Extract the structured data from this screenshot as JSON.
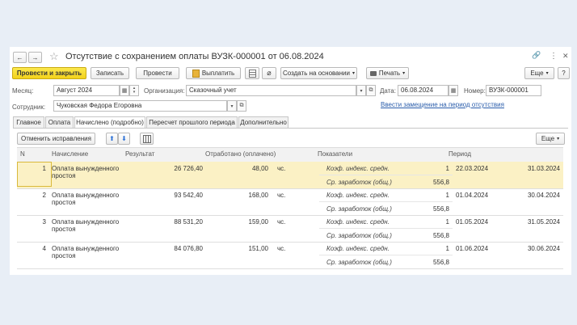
{
  "window": {
    "title": "Отсутствие с сохранением оплаты ВУЗК-000001 от 06.08.2024",
    "nav_back_icon": "←",
    "nav_forward_icon": "→",
    "star_icon": "☆",
    "link_icon": "🔗",
    "menu_icon": "⋮",
    "close_icon": "✕"
  },
  "toolbar": {
    "post_close": "Провести и закрыть",
    "save": "Записать",
    "post": "Провести",
    "pay": "Выплатить",
    "based_on": "Создать на основании",
    "print": "Печать",
    "more": "Еще",
    "help": "?"
  },
  "form": {
    "month_label": "Месяц:",
    "month_value": "Август 2024",
    "org_label": "Организация:",
    "org_value": "Сказочный учет",
    "date_label": "Дата:",
    "date_value": "06.08.2024",
    "number_label": "Номер:",
    "number_value": "ВУЗК-000001",
    "employee_label": "Сотрудник:",
    "employee_value": "Чуковская Федора Егоровна",
    "substitution_link": "Ввести замещение на период отсутствия"
  },
  "tabs": [
    "Главное",
    "Оплата",
    "Начислено (подробно)",
    "Пересчет прошлого периода",
    "Дополнительно"
  ],
  "active_tab": 2,
  "table_toolbar": {
    "cancel_fix": "Отменить исправления",
    "more": "Еще"
  },
  "table": {
    "headers": {
      "n": "N",
      "accrual": "Начисление",
      "result": "Результат",
      "worked": "Отработано (оплачено)",
      "indicators": "Показатели",
      "period": "Период"
    },
    "rows": [
      {
        "n": "1",
        "accrual_l1": "Оплата вынужденного",
        "accrual_l2": "простоя",
        "result": "26 726,40",
        "worked": "48,00",
        "unit": "чс.",
        "ind1": "Коэф. индекс. средн.",
        "ind1_val": "1",
        "ind2": "Ср. заработок (общ.)",
        "ind2_val": "556,8",
        "from": "22.03.2024",
        "to": "31.03.2024"
      },
      {
        "n": "2",
        "accrual_l1": "Оплата вынужденного",
        "accrual_l2": "простоя",
        "result": "93 542,40",
        "worked": "168,00",
        "unit": "чс.",
        "ind1": "Коэф. индекс. средн.",
        "ind1_val": "1",
        "ind2": "Ср. заработок (общ.)",
        "ind2_val": "556,8",
        "from": "01.04.2024",
        "to": "30.04.2024"
      },
      {
        "n": "3",
        "accrual_l1": "Оплата вынужденного",
        "accrual_l2": "простоя",
        "result": "88 531,20",
        "worked": "159,00",
        "unit": "чс.",
        "ind1": "Коэф. индекс. средн.",
        "ind1_val": "1",
        "ind2": "Ср. заработок (общ.)",
        "ind2_val": "556,8",
        "from": "01.05.2024",
        "to": "31.05.2024"
      },
      {
        "n": "4",
        "accrual_l1": "Оплата вынужденного",
        "accrual_l2": "простоя",
        "result": "84 076,80",
        "worked": "151,00",
        "unit": "чс.",
        "ind1": "Коэф. индекс. средн.",
        "ind1_val": "1",
        "ind2": "Ср. заработок (общ.)",
        "ind2_val": "556,8",
        "from": "01.06.2024",
        "to": "30.06.2024"
      }
    ]
  },
  "colors": {
    "primary_button": "#f3d21a",
    "selected_row": "#fbf1c5",
    "link": "#2a5dab"
  }
}
